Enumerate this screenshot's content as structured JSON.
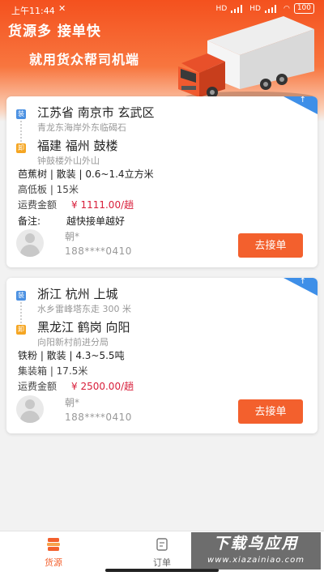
{
  "status": {
    "time": "上午11:44",
    "battery": "100",
    "signal1": "HD",
    "signal2": "HD"
  },
  "header": {
    "slogan1": "货源多  接单快",
    "slogan2": "就用货众帮司机端"
  },
  "orders": [
    {
      "load_tag": "装",
      "unload_tag": "卸",
      "load_city": "江苏省 南京市 玄武区",
      "load_addr": "青龙东海岸外东临碣石",
      "unload_city": "福建 福州 鼓楼",
      "unload_addr": "钟鼓楼外山外山",
      "goods": "芭蕉树 | 散装 | 0.6~1.4立方米",
      "truck": "高低板 | 15米",
      "fee_label": "运费金额",
      "fee_value": "¥ 1111.00/趟",
      "remark_label": "备注:",
      "remark_value": "越快接单越好",
      "user_name": "朝*",
      "user_phone": "188****0410",
      "button": "去接单",
      "corner_arrow": "↑"
    },
    {
      "load_tag": "装",
      "unload_tag": "卸",
      "load_city": "浙江 杭州 上城",
      "load_addr": "水乡雷峰塔东走 300 米",
      "unload_city": "黑龙江 鹤岗 向阳",
      "unload_addr": "向阳新村前进分局",
      "goods": "铁粉 | 散装 | 4.3~5.5吨",
      "truck": "集装箱 | 17.5米",
      "fee_label": "运费金额",
      "fee_value": "¥ 2500.00/趟",
      "user_name": "朝*",
      "user_phone": "188****0410",
      "button": "去接单",
      "corner_arrow": "↑"
    }
  ],
  "tabs": [
    {
      "label": "货源",
      "icon": "cargo-stack-icon",
      "active": true
    },
    {
      "label": "订单",
      "icon": "order-icon",
      "active": false
    }
  ],
  "watermark": {
    "line1": "下载鸟应用",
    "line2": "www.xiazainiao.com"
  },
  "colors": {
    "primary": "#f3602d",
    "price": "#d81e3a",
    "corner": "#3e8fe8",
    "load_tag": "#4a90e2",
    "unload_tag": "#f5a623"
  }
}
